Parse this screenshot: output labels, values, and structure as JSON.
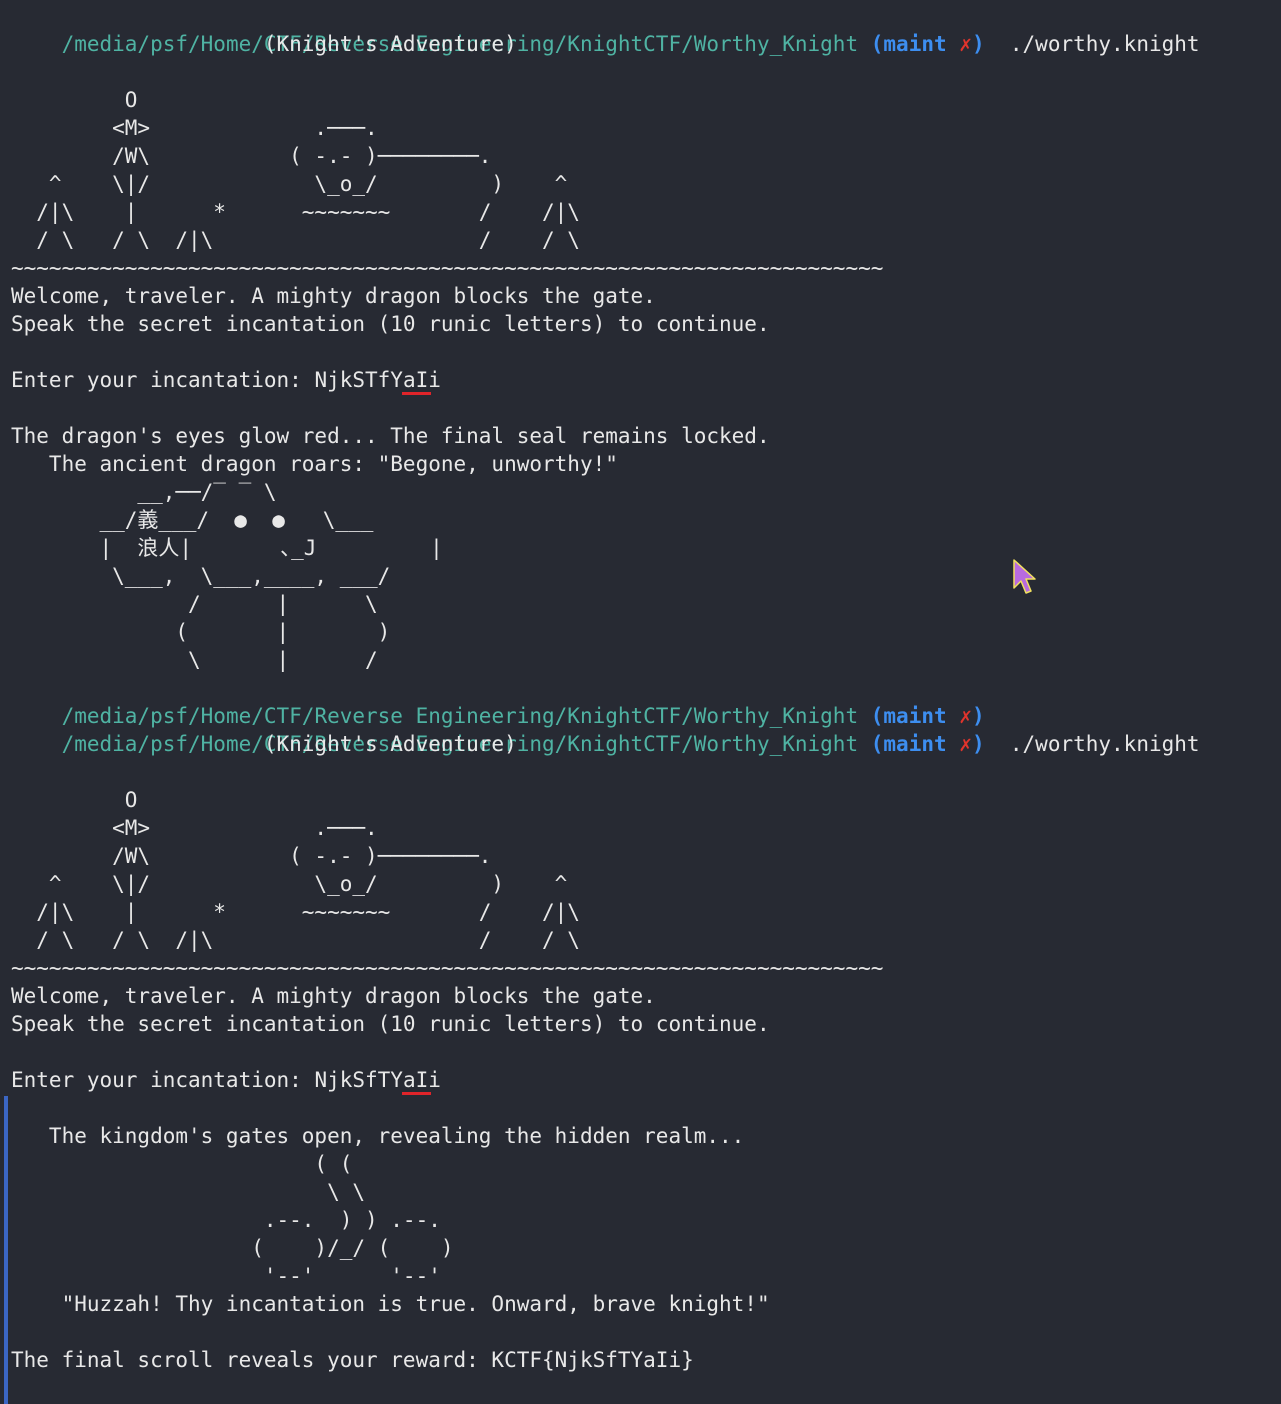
{
  "prompt": {
    "path": "/media/psf/Home/CTF/Reverse Engineering/KnightCTF/Worthy_Knight",
    "branch_open": "(",
    "branch_name": "maint",
    "branch_mark": "✗",
    "branch_close": ")",
    "command": "./worthy.knight"
  },
  "run1": {
    "banner_title": "                    (Knight's Adventure)",
    "knight_art": [
      "         O",
      "        <M>             .───.",
      "        /W\\           ( -.- )────────.",
      "   ^    \\|/             \\_o_/         )    ^",
      "  /|\\    |      *      ~~~~~~~       /    /|\\",
      "  / \\   / \\  /|\\                     /    / \\"
    ],
    "divider": "~~~~~~~~~~~~~~~~~~~~~~~~~~~~~~~~~~~~~~~~~~~~~~~~~~~~~~~~~~~~~~~~~~~~~",
    "welcome": "Welcome, traveler. A mighty dragon blocks the gate.",
    "instruction": "Speak the secret incantation (10 runic letters) to continue.",
    "input_label": "Enter your incantation: ",
    "input_value": "NjkSTfYaIi",
    "result_line": "The dragon's eyes glow red... The final seal remains locked.",
    "roar_line": "   The ancient dragon roars: \"Begone, unworthy!\"",
    "dragon_art": [
      "          __,──/‾ ‾ \\",
      "       __/義___/  ●  ●   \\___",
      "       |  浪人|       ､_J         |",
      "        \\___,  \\___,____, ___/",
      "              /      |      \\",
      "             (       |       )",
      "              \\      |      /"
    ]
  },
  "run2": {
    "banner_title": "                    (Knight's Adventure)",
    "knight_art": [
      "         O",
      "        <M>             .───.",
      "        /W\\           ( -.- )────────.",
      "   ^    \\|/             \\_o_/         )    ^",
      "  /|\\    |      *      ~~~~~~~       /    /|\\",
      "  / \\   / \\  /|\\                     /    / \\"
    ],
    "divider": "~~~~~~~~~~~~~~~~~~~~~~~~~~~~~~~~~~~~~~~~~~~~~~~~~~~~~~~~~~~~~~~~~~~~~",
    "welcome": "Welcome, traveler. A mighty dragon blocks the gate.",
    "instruction": "Speak the secret incantation (10 runic letters) to continue.",
    "input_label": "Enter your incantation: ",
    "input_value": "NjkSfTYaIi",
    "success_line": "   The kingdom's gates open, revealing the hidden realm...",
    "cup_art": [
      "                        ( (",
      "                         \\ \\",
      "                    .--.  ) ) .--.",
      "                   (    )/_/ (    )",
      "                    '--'      '--'"
    ],
    "huzzah": "    \"Huzzah! Thy incantation is true. Onward, brave knight!\"",
    "reward": "The final scroll reveals your reward: KCTF{NjkSfTYaIi}"
  },
  "colors": {
    "background": "#272a33",
    "path": "#4fb3a3",
    "branch": "#3d8ef0",
    "dirty_mark": "#e0342c",
    "text": "#e8e8e8",
    "spell_underline": "#e0242a",
    "block_bar": "#3b66c4",
    "cursor": "#b86adf"
  }
}
